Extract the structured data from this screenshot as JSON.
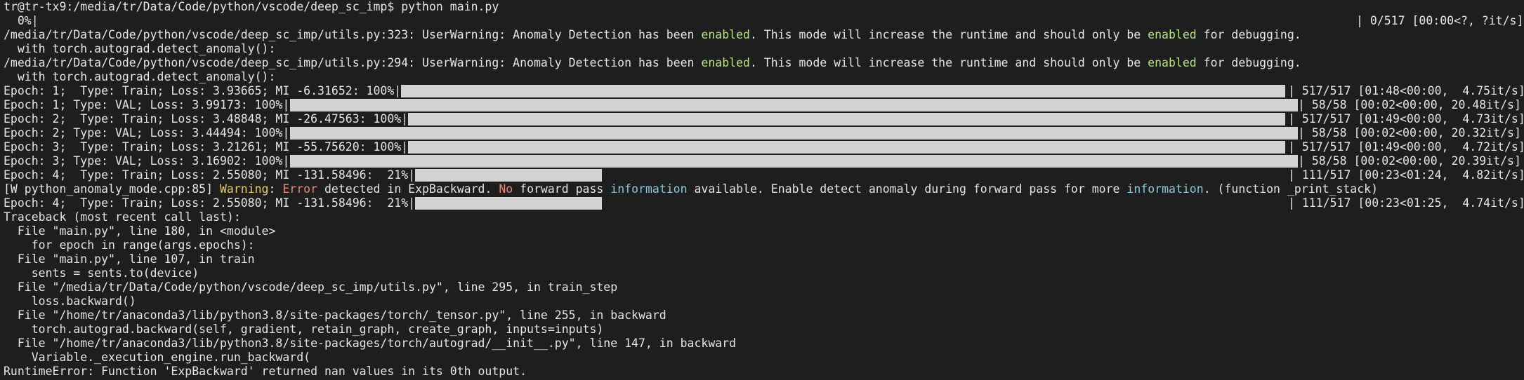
{
  "terminal": {
    "prompt": "tr@tr-tx9:/media/tr/Data/Code/python/vscode/deep_sc_imp$ python main.py",
    "initial_progress": {
      "left": "  0%|",
      "right": "| 0/517 [00:00<?, ?it/s]"
    },
    "warnings": [
      {
        "prefix": "/media/tr/Data/Code/python/vscode/deep_sc_imp/utils.py:323: UserWarning: Anomaly Detection has been ",
        "w1": "enabled",
        "mid": ". This mode will increase the runtime and should only be ",
        "w2": "enabled",
        "suffix": " for debugging.",
        "code": "  with torch.autograd.detect_anomaly():"
      },
      {
        "prefix": "/media/tr/Data/Code/python/vscode/deep_sc_imp/utils.py:294: UserWarning: Anomaly Detection has been ",
        "w1": "enabled",
        "mid": ". This mode will increase the runtime and should only be ",
        "w2": "enabled",
        "suffix": " for debugging.",
        "code": "  with torch.autograd.detect_anomaly():"
      }
    ],
    "progress_lines": [
      {
        "left": "Epoch: 1;  Type: Train; Loss: 3.93665; MI -6.31652: 100%|",
        "progress": 1.0,
        "right": "| 517/517 [01:48<00:00,  4.75it/s]",
        "variant": "r1"
      },
      {
        "left": "Epoch: 1; Type: VAL; Loss: 3.99173: 100%|",
        "progress": 1.0,
        "right": "| 58/58 [00:02<00:00, 20.48it/s]",
        "variant": "r2"
      },
      {
        "left": "Epoch: 2;  Type: Train; Loss: 3.48848; MI -26.47563: 100%|",
        "progress": 1.0,
        "right": "| 517/517 [01:49<00:00,  4.73it/s]",
        "variant": "r1"
      },
      {
        "left": "Epoch: 2; Type: VAL; Loss: 3.44494: 100%|",
        "progress": 1.0,
        "right": "| 58/58 [00:02<00:00, 20.32it/s]",
        "variant": "r2"
      },
      {
        "left": "Epoch: 3;  Type: Train; Loss: 3.21261; MI -55.75620: 100%|",
        "progress": 1.0,
        "right": "| 517/517 [01:49<00:00,  4.72it/s]",
        "variant": "r1"
      },
      {
        "left": "Epoch: 3; Type: VAL; Loss: 3.16902: 100%|",
        "progress": 1.0,
        "right": "| 58/58 [00:02<00:00, 20.39it/s]",
        "variant": "r2"
      },
      {
        "left": "Epoch: 4;  Type: Train; Loss: 2.55080; MI -131.58496:  21%|",
        "progress": 0.215,
        "right": "| 111/517 [00:23<01:24,  4.82it/s]",
        "variant": "r1"
      }
    ],
    "error_line": {
      "p1": "[W python_anomaly_mode.cpp:85] ",
      "warning": "Warning",
      "p2": ": ",
      "error": "Error",
      "p3": " detected in ExpBackward. ",
      "no": "No",
      "p4": " forward pass ",
      "information": "information",
      "p5": " available. Enable detect anomaly during forward pass for more ",
      "information2": "information",
      "p6": ". (function _print_stack)"
    },
    "progress_after": {
      "left": "Epoch: 4;  Type: Train; Loss: 2.55080; MI -131.58496:  21%|",
      "progress": 0.215,
      "right": "| 111/517 [00:23<01:25,  4.74it/s]",
      "variant": "r1"
    },
    "traceback": [
      "Traceback (most recent call last):",
      "  File \"main.py\", line 180, in <module>",
      "    for epoch in range(args.epochs):",
      "  File \"main.py\", line 107, in train",
      "    sents = sents.to(device)",
      "  File \"/media/tr/Data/Code/python/vscode/deep_sc_imp/utils.py\", line 295, in train_step",
      "    loss.backward()",
      "  File \"/home/tr/anaconda3/lib/python3.8/site-packages/torch/_tensor.py\", line 255, in backward",
      "    torch.autograd.backward(self, gradient, retain_graph, create_graph, inputs=inputs)",
      "  File \"/home/tr/anaconda3/lib/python3.8/site-packages/torch/autograd/__init__.py\", line 147, in backward",
      "    Variable._execution_engine.run_backward(",
      "RuntimeError: Function 'ExpBackward' returned nan values in its 0th output."
    ]
  }
}
